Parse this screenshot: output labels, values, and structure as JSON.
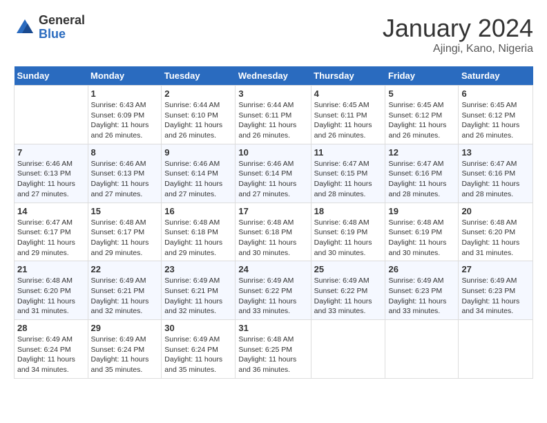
{
  "logo": {
    "general": "General",
    "blue": "Blue"
  },
  "title": "January 2024",
  "location": "Ajingi, Kano, Nigeria",
  "weekdays": [
    "Sunday",
    "Monday",
    "Tuesday",
    "Wednesday",
    "Thursday",
    "Friday",
    "Saturday"
  ],
  "weeks": [
    [
      {
        "day": "",
        "sunrise": "",
        "sunset": "",
        "daylight": ""
      },
      {
        "day": "1",
        "sunrise": "Sunrise: 6:43 AM",
        "sunset": "Sunset: 6:09 PM",
        "daylight": "Daylight: 11 hours and 26 minutes."
      },
      {
        "day": "2",
        "sunrise": "Sunrise: 6:44 AM",
        "sunset": "Sunset: 6:10 PM",
        "daylight": "Daylight: 11 hours and 26 minutes."
      },
      {
        "day": "3",
        "sunrise": "Sunrise: 6:44 AM",
        "sunset": "Sunset: 6:11 PM",
        "daylight": "Daylight: 11 hours and 26 minutes."
      },
      {
        "day": "4",
        "sunrise": "Sunrise: 6:45 AM",
        "sunset": "Sunset: 6:11 PM",
        "daylight": "Daylight: 11 hours and 26 minutes."
      },
      {
        "day": "5",
        "sunrise": "Sunrise: 6:45 AM",
        "sunset": "Sunset: 6:12 PM",
        "daylight": "Daylight: 11 hours and 26 minutes."
      },
      {
        "day": "6",
        "sunrise": "Sunrise: 6:45 AM",
        "sunset": "Sunset: 6:12 PM",
        "daylight": "Daylight: 11 hours and 26 minutes."
      }
    ],
    [
      {
        "day": "7",
        "sunrise": "Sunrise: 6:46 AM",
        "sunset": "Sunset: 6:13 PM",
        "daylight": "Daylight: 11 hours and 27 minutes."
      },
      {
        "day": "8",
        "sunrise": "Sunrise: 6:46 AM",
        "sunset": "Sunset: 6:13 PM",
        "daylight": "Daylight: 11 hours and 27 minutes."
      },
      {
        "day": "9",
        "sunrise": "Sunrise: 6:46 AM",
        "sunset": "Sunset: 6:14 PM",
        "daylight": "Daylight: 11 hours and 27 minutes."
      },
      {
        "day": "10",
        "sunrise": "Sunrise: 6:46 AM",
        "sunset": "Sunset: 6:14 PM",
        "daylight": "Daylight: 11 hours and 27 minutes."
      },
      {
        "day": "11",
        "sunrise": "Sunrise: 6:47 AM",
        "sunset": "Sunset: 6:15 PM",
        "daylight": "Daylight: 11 hours and 28 minutes."
      },
      {
        "day": "12",
        "sunrise": "Sunrise: 6:47 AM",
        "sunset": "Sunset: 6:16 PM",
        "daylight": "Daylight: 11 hours and 28 minutes."
      },
      {
        "day": "13",
        "sunrise": "Sunrise: 6:47 AM",
        "sunset": "Sunset: 6:16 PM",
        "daylight": "Daylight: 11 hours and 28 minutes."
      }
    ],
    [
      {
        "day": "14",
        "sunrise": "Sunrise: 6:47 AM",
        "sunset": "Sunset: 6:17 PM",
        "daylight": "Daylight: 11 hours and 29 minutes."
      },
      {
        "day": "15",
        "sunrise": "Sunrise: 6:48 AM",
        "sunset": "Sunset: 6:17 PM",
        "daylight": "Daylight: 11 hours and 29 minutes."
      },
      {
        "day": "16",
        "sunrise": "Sunrise: 6:48 AM",
        "sunset": "Sunset: 6:18 PM",
        "daylight": "Daylight: 11 hours and 29 minutes."
      },
      {
        "day": "17",
        "sunrise": "Sunrise: 6:48 AM",
        "sunset": "Sunset: 6:18 PM",
        "daylight": "Daylight: 11 hours and 30 minutes."
      },
      {
        "day": "18",
        "sunrise": "Sunrise: 6:48 AM",
        "sunset": "Sunset: 6:19 PM",
        "daylight": "Daylight: 11 hours and 30 minutes."
      },
      {
        "day": "19",
        "sunrise": "Sunrise: 6:48 AM",
        "sunset": "Sunset: 6:19 PM",
        "daylight": "Daylight: 11 hours and 30 minutes."
      },
      {
        "day": "20",
        "sunrise": "Sunrise: 6:48 AM",
        "sunset": "Sunset: 6:20 PM",
        "daylight": "Daylight: 11 hours and 31 minutes."
      }
    ],
    [
      {
        "day": "21",
        "sunrise": "Sunrise: 6:48 AM",
        "sunset": "Sunset: 6:20 PM",
        "daylight": "Daylight: 11 hours and 31 minutes."
      },
      {
        "day": "22",
        "sunrise": "Sunrise: 6:49 AM",
        "sunset": "Sunset: 6:21 PM",
        "daylight": "Daylight: 11 hours and 32 minutes."
      },
      {
        "day": "23",
        "sunrise": "Sunrise: 6:49 AM",
        "sunset": "Sunset: 6:21 PM",
        "daylight": "Daylight: 11 hours and 32 minutes."
      },
      {
        "day": "24",
        "sunrise": "Sunrise: 6:49 AM",
        "sunset": "Sunset: 6:22 PM",
        "daylight": "Daylight: 11 hours and 33 minutes."
      },
      {
        "day": "25",
        "sunrise": "Sunrise: 6:49 AM",
        "sunset": "Sunset: 6:22 PM",
        "daylight": "Daylight: 11 hours and 33 minutes."
      },
      {
        "day": "26",
        "sunrise": "Sunrise: 6:49 AM",
        "sunset": "Sunset: 6:23 PM",
        "daylight": "Daylight: 11 hours and 33 minutes."
      },
      {
        "day": "27",
        "sunrise": "Sunrise: 6:49 AM",
        "sunset": "Sunset: 6:23 PM",
        "daylight": "Daylight: 11 hours and 34 minutes."
      }
    ],
    [
      {
        "day": "28",
        "sunrise": "Sunrise: 6:49 AM",
        "sunset": "Sunset: 6:24 PM",
        "daylight": "Daylight: 11 hours and 34 minutes."
      },
      {
        "day": "29",
        "sunrise": "Sunrise: 6:49 AM",
        "sunset": "Sunset: 6:24 PM",
        "daylight": "Daylight: 11 hours and 35 minutes."
      },
      {
        "day": "30",
        "sunrise": "Sunrise: 6:49 AM",
        "sunset": "Sunset: 6:24 PM",
        "daylight": "Daylight: 11 hours and 35 minutes."
      },
      {
        "day": "31",
        "sunrise": "Sunrise: 6:48 AM",
        "sunset": "Sunset: 6:25 PM",
        "daylight": "Daylight: 11 hours and 36 minutes."
      },
      {
        "day": "",
        "sunrise": "",
        "sunset": "",
        "daylight": ""
      },
      {
        "day": "",
        "sunrise": "",
        "sunset": "",
        "daylight": ""
      },
      {
        "day": "",
        "sunrise": "",
        "sunset": "",
        "daylight": ""
      }
    ]
  ]
}
